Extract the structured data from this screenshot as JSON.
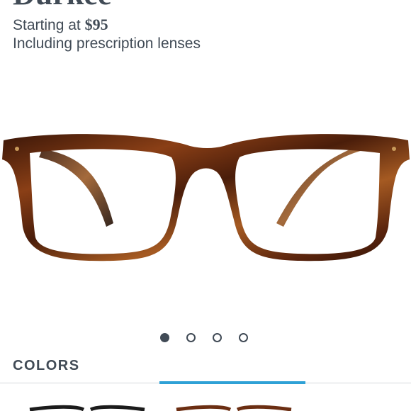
{
  "product": {
    "name": "Durkee",
    "price_prefix": "Starting at",
    "price": "$95",
    "lens_note": "Including prescription lenses",
    "frame_color": "#6b2e12"
  },
  "carousel": {
    "total": 4,
    "active_index": 0
  },
  "colors_section": {
    "heading": "COLORS",
    "selected_swatch_index": 1,
    "accent": "#2fa1d6"
  }
}
